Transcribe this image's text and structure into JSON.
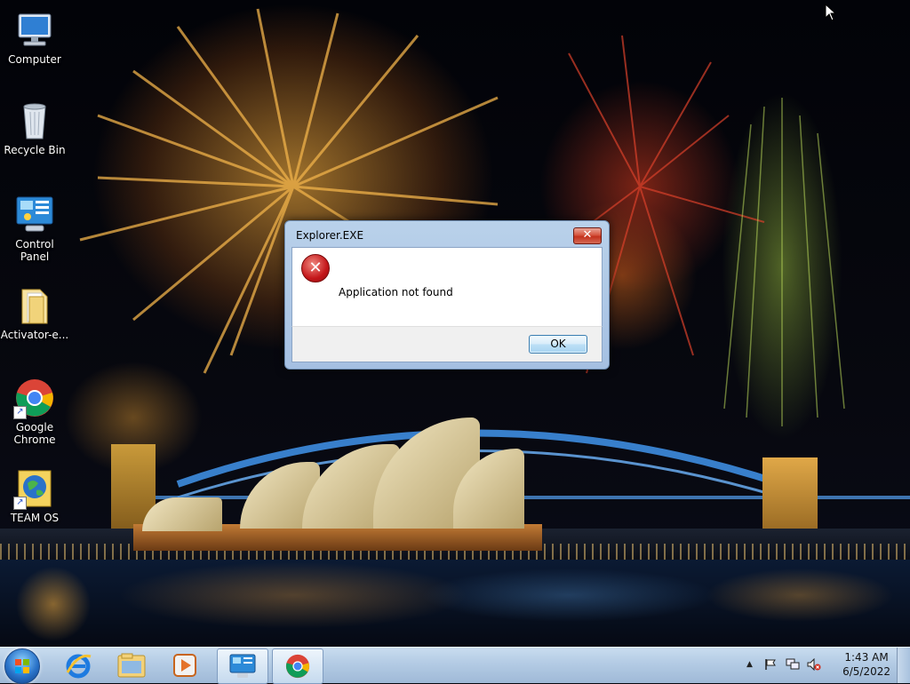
{
  "desktop": {
    "icons": [
      {
        "label": "Computer",
        "icon": "computer-icon"
      },
      {
        "label": "Recycle Bin",
        "icon": "recycle-bin-icon"
      },
      {
        "label": "Control Panel",
        "icon": "control-panel-icon"
      },
      {
        "label": "Activator-e...",
        "icon": "folder-icon"
      },
      {
        "label": "Google Chrome",
        "icon": "chrome-icon"
      },
      {
        "label": "TEAM OS",
        "icon": "globe-icon"
      }
    ]
  },
  "dialog": {
    "title": "Explorer.EXE",
    "message": "Application not found",
    "ok_label": "OK",
    "close_glyph": "✕",
    "icon": "error-icon"
  },
  "taskbar": {
    "pinned": [
      {
        "name": "internet-explorer",
        "icon": "ie-icon"
      },
      {
        "name": "windows-explorer",
        "icon": "folder-icon"
      },
      {
        "name": "media-player",
        "icon": "media-player-icon"
      },
      {
        "name": "control-panel",
        "icon": "control-panel-icon"
      },
      {
        "name": "chrome",
        "icon": "chrome-icon"
      }
    ],
    "clock": {
      "time": "1:43 AM",
      "date": "6/5/2022"
    },
    "tray_icons": [
      "up-arrow-icon",
      "flag-icon",
      "network-icon",
      "volume-muted-icon"
    ]
  },
  "colors": {
    "accent": "#2a73c9",
    "error": "#c4161a"
  }
}
